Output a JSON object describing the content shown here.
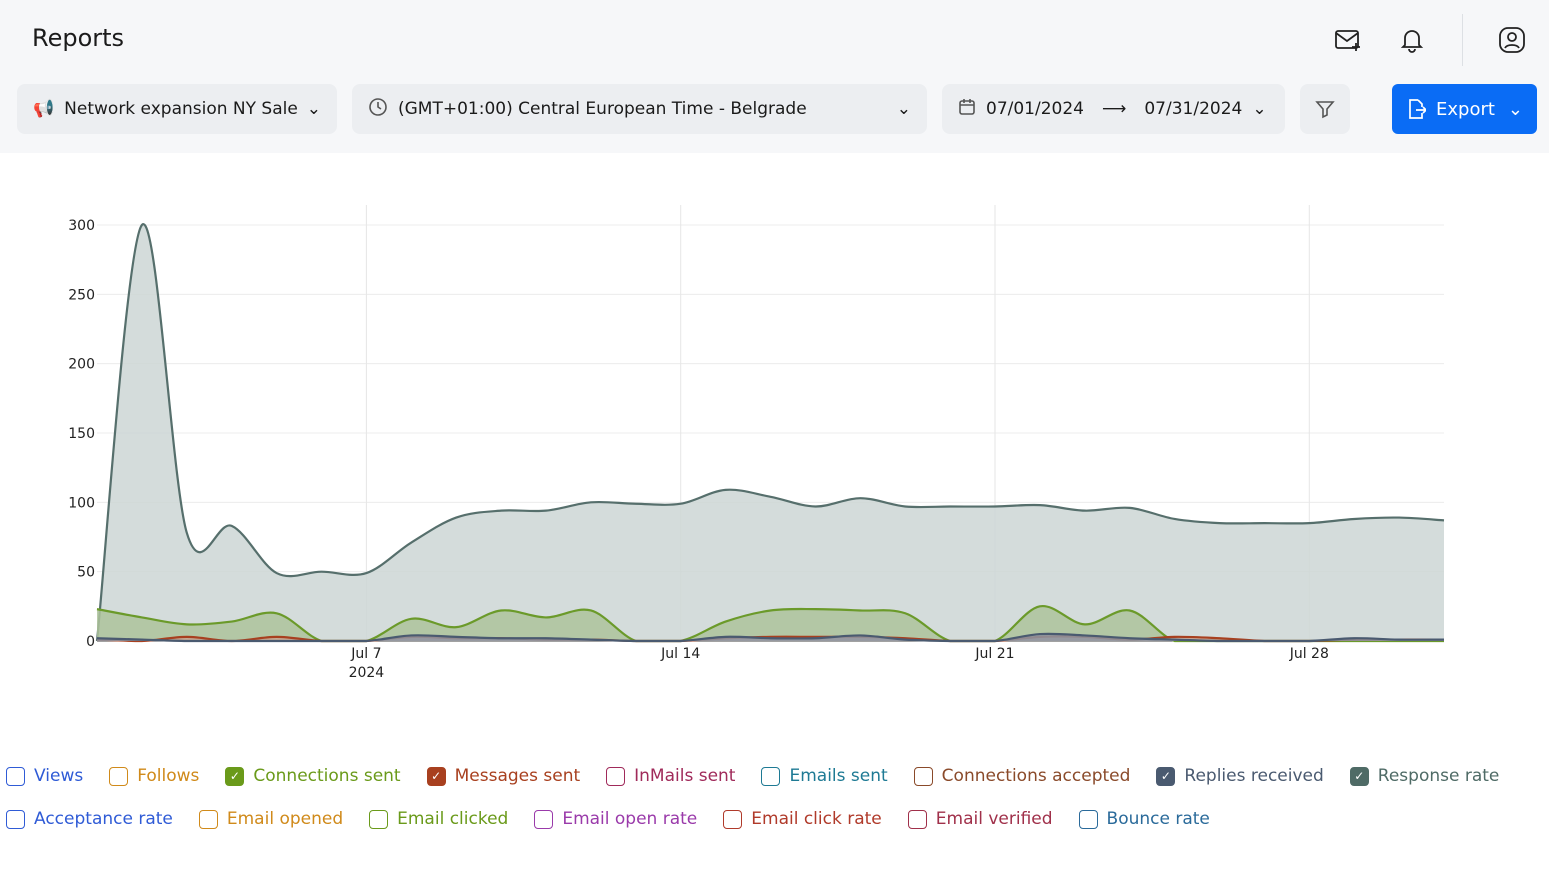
{
  "header": {
    "title": "Reports",
    "icons": [
      "mail-plus-icon",
      "bell-icon",
      "user-circle-icon"
    ]
  },
  "filters": {
    "campaign": "Network expansion NY Sales",
    "timezone": "(GMT+01:00) Central European Time - Belgrade",
    "date_from": "07/01/2024",
    "date_to": "07/31/2024",
    "export_label": "Export"
  },
  "chart_data": {
    "type": "area",
    "x": [
      "2024-07-01",
      "2024-07-02",
      "2024-07-03",
      "2024-07-04",
      "2024-07-05",
      "2024-07-06",
      "2024-07-07",
      "2024-07-08",
      "2024-07-09",
      "2024-07-10",
      "2024-07-11",
      "2024-07-12",
      "2024-07-13",
      "2024-07-14",
      "2024-07-15",
      "2024-07-16",
      "2024-07-17",
      "2024-07-18",
      "2024-07-19",
      "2024-07-20",
      "2024-07-21",
      "2024-07-22",
      "2024-07-23",
      "2024-07-24",
      "2024-07-25",
      "2024-07-26",
      "2024-07-27",
      "2024-07-28",
      "2024-07-29",
      "2024-07-30",
      "2024-07-31"
    ],
    "xticks": [
      {
        "date": "2024-07-07",
        "label": "Jul 7",
        "sub": "2024"
      },
      {
        "date": "2024-07-14",
        "label": "Jul 14"
      },
      {
        "date": "2024-07-21",
        "label": "Jul 21"
      },
      {
        "date": "2024-07-28",
        "label": "Jul 28"
      }
    ],
    "yticks": [
      0,
      50,
      100,
      150,
      200,
      250,
      300
    ],
    "ylim": [
      0,
      310
    ],
    "grid": true,
    "series": [
      {
        "name": "Response rate",
        "color": "#566f6c",
        "fill": "#ccd6d5",
        "values": [
          0,
          300,
          78,
          83,
          49,
          50,
          49,
          71,
          89,
          94,
          94,
          100,
          99,
          99,
          109,
          104,
          97,
          103,
          97,
          97,
          97,
          98,
          94,
          96,
          88,
          85,
          85,
          85,
          88,
          89,
          87
        ]
      },
      {
        "name": "Connections sent",
        "color": "#6b9a2a",
        "fill": "#adc39b",
        "values": [
          23,
          17,
          12,
          14,
          20,
          0,
          0,
          16,
          10,
          22,
          17,
          22,
          0,
          0,
          14,
          22,
          23,
          22,
          20,
          0,
          0,
          25,
          12,
          22,
          0,
          0,
          0,
          0,
          0,
          0,
          0
        ]
      },
      {
        "name": "Messages sent",
        "color": "#a8401f",
        "fill": "#c9a38f",
        "values": [
          1,
          0,
          3,
          0,
          3,
          0,
          0,
          3,
          2,
          2,
          1,
          1,
          0,
          0,
          2,
          3,
          3,
          3,
          2,
          0,
          0,
          3,
          3,
          1,
          3,
          2,
          0,
          0,
          1,
          1,
          1
        ]
      },
      {
        "name": "Replies received",
        "color": "#4a5a70",
        "fill": "#8d97a3",
        "values": [
          2,
          1,
          0,
          0,
          0,
          0,
          0,
          4,
          3,
          2,
          2,
          1,
          0,
          0,
          3,
          2,
          2,
          4,
          1,
          0,
          0,
          5,
          4,
          2,
          1,
          0,
          0,
          0,
          2,
          1,
          1
        ]
      }
    ]
  },
  "legend": [
    [
      {
        "label": "Views",
        "color": "#2f5bd6",
        "checked": false
      },
      {
        "label": "Follows",
        "color": "#d08a1a",
        "checked": false
      },
      {
        "label": "Connections sent",
        "color": "#6a9a1a",
        "checked": true
      },
      {
        "label": "Messages sent",
        "color": "#a8401f",
        "checked": true
      },
      {
        "label": "InMails sent",
        "color": "#a02a5a",
        "checked": false
      },
      {
        "label": "Emails sent",
        "color": "#1e7a94",
        "checked": false
      },
      {
        "label": "Connections accepted",
        "color": "#8a4a2a",
        "checked": false
      },
      {
        "label": "Replies received",
        "color": "#4a5a70",
        "checked": true
      },
      {
        "label": "Response rate",
        "color": "#4f6b66",
        "checked": true
      }
    ],
    [
      {
        "label": "Acceptance rate",
        "color": "#2f5bd6",
        "checked": false
      },
      {
        "label": "Email opened",
        "color": "#d08a1a",
        "checked": false
      },
      {
        "label": "Email clicked",
        "color": "#6a9a1a",
        "checked": false
      },
      {
        "label": "Email open rate",
        "color": "#9a3aaa",
        "checked": false
      },
      {
        "label": "Email click rate",
        "color": "#b03a2a",
        "checked": false
      },
      {
        "label": "Email verified",
        "color": "#a0304a",
        "checked": false
      },
      {
        "label": "Bounce rate",
        "color": "#2a6a9a",
        "checked": false
      }
    ]
  ]
}
